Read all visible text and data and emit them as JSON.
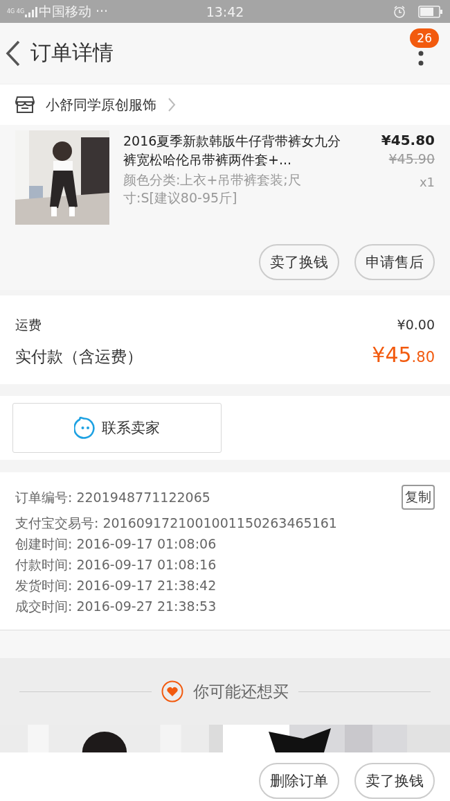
{
  "status_bar": {
    "network": "4G 4G",
    "carrier": "中国移动 ···",
    "time": "13:42"
  },
  "nav": {
    "title": "订单详情",
    "badge": "26"
  },
  "shop": {
    "name": "小舒同学原创服饰"
  },
  "product": {
    "kind": "picture",
    "title": "2016夏季新款韩版牛仔背带裤女九分裤宽松哈伦吊带裤两件套+...",
    "sku": "颜色分类:上衣+吊带裤套装;尺寸:S[建议80-95斤]",
    "price": "¥45.80",
    "original_price": "¥45.90",
    "quantity": "x1",
    "buttons": [
      "卖了换钱",
      "申请售后"
    ]
  },
  "costs": {
    "shipping_label": "运费",
    "shipping": "¥0.00",
    "paid_label": "实付款（含运费）",
    "paid_main": "¥45",
    "paid_fraction": ".80"
  },
  "contact": {
    "label": "联系卖家"
  },
  "order_info": {
    "lines": [
      "订单编号: 2201948771122065",
      "支付宝交易号: 2016091721001001150263465161",
      "创建时间: 2016-09-17 01:08:06",
      "付款时间: 2016-09-17 01:08:16",
      "发货时间: 2016-09-17 21:38:42",
      "成交时间: 2016-09-27 21:38:53"
    ],
    "copy_button": "复制"
  },
  "recommend": {
    "title": "你可能还想买"
  },
  "bottom_bar": {
    "buttons": [
      "删除订单",
      "卖了换钱"
    ]
  }
}
